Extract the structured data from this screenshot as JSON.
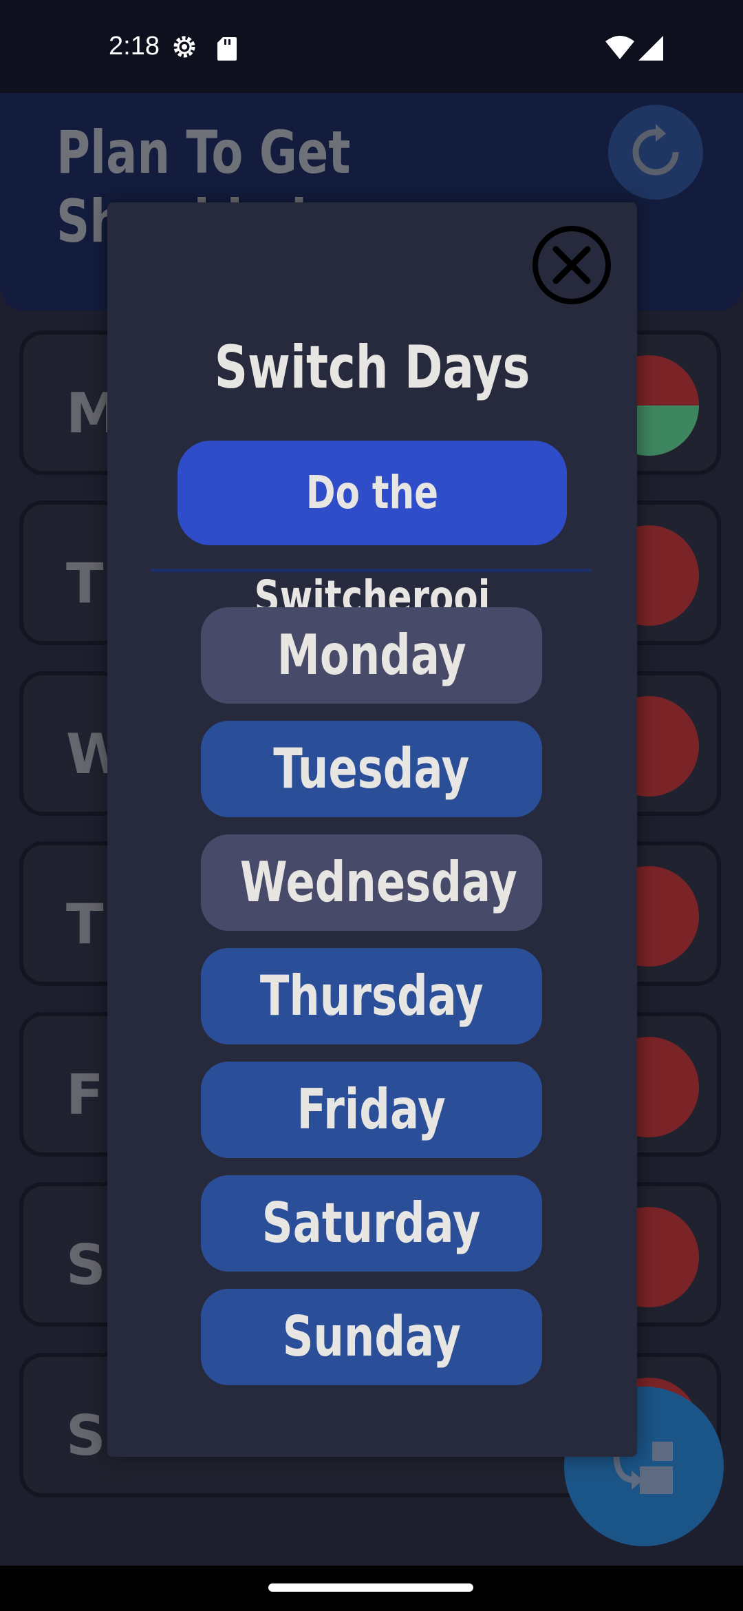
{
  "status": {
    "time": "2:18"
  },
  "app": {
    "title": "Plan To Get Shredded",
    "days": [
      {
        "letter": "M",
        "pie": "partial"
      },
      {
        "letter": "T",
        "pie": "red"
      },
      {
        "letter": "W",
        "pie": "red"
      },
      {
        "letter": "T",
        "pie": "red"
      },
      {
        "letter": "F",
        "pie": "red"
      },
      {
        "letter": "S",
        "pie": "red"
      },
      {
        "letter": "S",
        "pie": "red"
      }
    ]
  },
  "dialog": {
    "title": "Switch Days",
    "switch_button": "Do the Switcherooi",
    "days": [
      {
        "label": "Monday",
        "selected": false
      },
      {
        "label": "Tuesday",
        "selected": true
      },
      {
        "label": "Wednesday",
        "selected": false
      },
      {
        "label": "Thursday",
        "selected": true
      },
      {
        "label": "Friday",
        "selected": true
      },
      {
        "label": "Saturday",
        "selected": true
      },
      {
        "label": "Sunday",
        "selected": true
      }
    ]
  },
  "colors": {
    "accent": "#2f4cc9",
    "day_selected": "#2a4e98",
    "day_unselected": "#484a69",
    "dialog_bg": "#272a3d",
    "pie_red": "#7a2427",
    "pie_green": "#3e8660"
  },
  "icons": [
    "settings-icon",
    "sd-card-icon",
    "wifi-icon",
    "signal-icon",
    "reset-icon",
    "close-icon",
    "swap-icon"
  ]
}
